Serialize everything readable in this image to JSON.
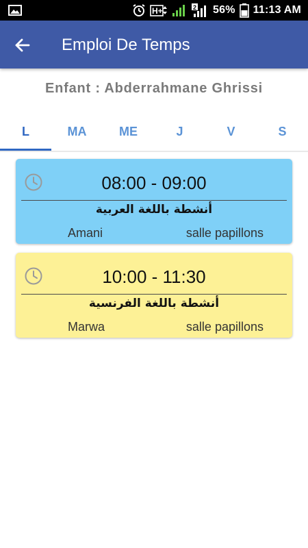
{
  "status_bar": {
    "battery_percent": "56%",
    "time": "11:13 AM",
    "icons": [
      "image-icon",
      "alarm-icon",
      "hplus-signal-icon",
      "signal-bars-icon",
      "sim2-signal-icon",
      "battery-icon"
    ]
  },
  "header": {
    "title": "Emploi De Temps",
    "back_icon": "arrow-left-icon",
    "color": "#3f5aa6"
  },
  "child": {
    "label": "Enfant : Abderrahmane Ghrissi"
  },
  "tabs": [
    {
      "label": "L",
      "active": true
    },
    {
      "label": "MA",
      "active": false
    },
    {
      "label": "ME",
      "active": false
    },
    {
      "label": "J",
      "active": false
    },
    {
      "label": "V",
      "active": false
    },
    {
      "label": "S",
      "active": false
    }
  ],
  "sessions": [
    {
      "time": "08:00 - 09:00",
      "activity": "أنشطة باللغة العربية",
      "teacher": "Amani",
      "room": "salle papillons",
      "color": "#7fd0f7"
    },
    {
      "time": "10:00 - 11:30",
      "activity": "أنشطة باللغة الفرنسية",
      "teacher": "Marwa",
      "room": "salle papillons",
      "color": "#fdf196"
    }
  ]
}
